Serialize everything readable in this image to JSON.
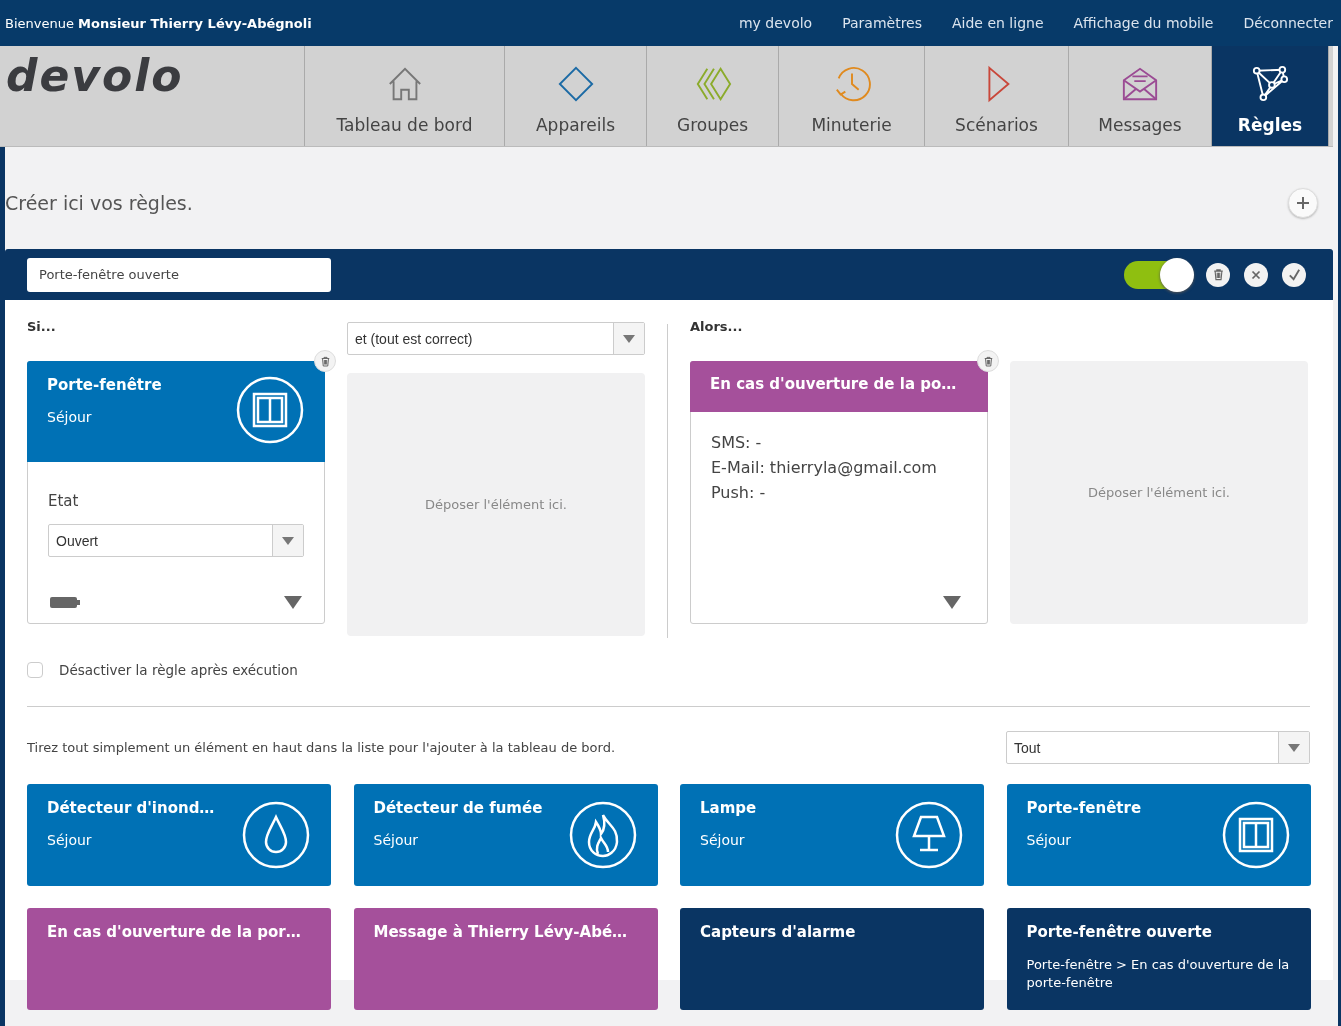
{
  "header": {
    "welcome": "Bienvenue",
    "user": "Monsieur Thierry Lévy-Abégnoli",
    "links": [
      "my devolo",
      "Paramètres",
      "Aide en ligne",
      "Affichage du mobile",
      "Déconnecter"
    ]
  },
  "logo": "devolo",
  "nav": [
    {
      "label": "Tableau de bord",
      "kind": "home",
      "selected": false
    },
    {
      "label": "Appareils",
      "kind": "devices",
      "selected": false
    },
    {
      "label": "Groupes",
      "kind": "groups",
      "selected": false
    },
    {
      "label": "Minuterie",
      "kind": "timer",
      "selected": false
    },
    {
      "label": "Scénarios",
      "kind": "scenes",
      "selected": false
    },
    {
      "label": "Messages",
      "kind": "messages",
      "selected": false
    },
    {
      "label": "Règles",
      "kind": "rules",
      "selected": true
    }
  ],
  "intro": "Créer ici vos règles.",
  "rule": {
    "name": "Porte-fenêtre ouverte",
    "active": true,
    "if_label": "Si...",
    "logic_select": "et (tout est correct)",
    "then_label": "Alors...",
    "condition": {
      "title": "Porte-fenêtre",
      "room": "Séjour",
      "field_label": "Etat",
      "value": "Ouvert"
    },
    "drop_hints": [
      "Déposer l'élément ici.",
      "Déposer l'élément ici."
    ],
    "action": {
      "title": "En cas d'ouverture de la po…",
      "lines": [
        "SMS: -",
        "E-Mail: thierryla@gmail.com",
        "Push: -"
      ]
    },
    "deactivate": {
      "label": "Désactiver la règle après exécution",
      "checked": false
    }
  },
  "library": {
    "hint": "Tirez tout simplement un élément en haut dans la liste pour l'ajouter à la tableau de bord.",
    "filter": "Tout",
    "items": [
      {
        "kind": "drop",
        "title": "Détecteur d'inond…",
        "subtitle": "Séjour"
      },
      {
        "kind": "flame",
        "title": "Détecteur de fumée",
        "subtitle": "Séjour"
      },
      {
        "kind": "lamp",
        "title": "Lampe",
        "subtitle": "Séjour"
      },
      {
        "kind": "window",
        "title": "Porte-fenêtre",
        "subtitle": "Séjour"
      },
      {
        "kind": "message",
        "title": "En cas d'ouverture de la por…"
      },
      {
        "kind": "message",
        "title": "Message à Thierry Lévy-Abé…"
      },
      {
        "kind": "rule",
        "title": "Capteurs d'alarme"
      },
      {
        "kind": "rule",
        "title": "Porte-fenêtre ouverte",
        "subtitle": "Porte-fenêtre > En cas d'ouverture de la porte-fenêtre"
      }
    ]
  }
}
